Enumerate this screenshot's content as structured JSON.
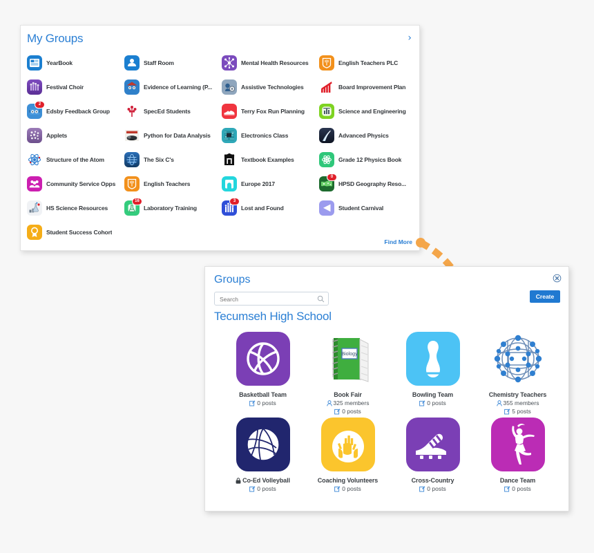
{
  "my_groups": {
    "title": "My Groups",
    "expand_icon": "chevron-right-icon",
    "find_more_label": "Find More",
    "items": [
      {
        "label": "YearBook",
        "icon": "yearbook-icon",
        "badge": null
      },
      {
        "label": "Staff Room",
        "icon": "staff-room-icon",
        "badge": null
      },
      {
        "label": "Mental Health Resources",
        "icon": "mental-health-icon",
        "badge": null
      },
      {
        "label": "English Teachers PLC",
        "icon": "book-shield-icon",
        "badge": null
      },
      {
        "label": "Festival Choir",
        "icon": "festival-choir-icon",
        "badge": null
      },
      {
        "label": "Evidence of Learning (P...",
        "icon": "robot-red-icon",
        "badge": null
      },
      {
        "label": "Assistive Technologies",
        "icon": "assistive-tech-icon",
        "badge": null
      },
      {
        "label": "Board Improvement Plan",
        "icon": "bar-chart-icon",
        "badge": null
      },
      {
        "label": "Edsby Feedback Group",
        "icon": "robot-blue-icon",
        "badge": "2"
      },
      {
        "label": "SpecEd Students",
        "icon": "tree-icon",
        "badge": null
      },
      {
        "label": "Terry Fox Run Planning",
        "icon": "running-shoe-icon",
        "badge": null
      },
      {
        "label": "Science and Engineering",
        "icon": "science-chart-icon",
        "badge": null
      },
      {
        "label": "Applets",
        "icon": "applets-icon",
        "badge": null
      },
      {
        "label": "Python for Data Analysis",
        "icon": "python-book-icon",
        "badge": null
      },
      {
        "label": "Electronics Class",
        "icon": "circuit-board-icon",
        "badge": null
      },
      {
        "label": "Advanced Physics",
        "icon": "lightning-icon",
        "badge": null
      },
      {
        "label": "Structure of the Atom",
        "icon": "atom-icon",
        "badge": null
      },
      {
        "label": "The Six C's",
        "icon": "globe-icon",
        "badge": null
      },
      {
        "label": "Textbook Examples",
        "icon": "building-icon",
        "badge": null
      },
      {
        "label": "Grade 12 Physics Book",
        "icon": "atom-green-icon",
        "badge": null
      },
      {
        "label": "Community Service Opps",
        "icon": "people-group-icon",
        "badge": null
      },
      {
        "label": "English Teachers",
        "icon": "book-shield-icon",
        "badge": null
      },
      {
        "label": "Europe 2017",
        "icon": "arch-icon",
        "badge": null
      },
      {
        "label": "HPSD Geography Reso...",
        "icon": "world-map-icon",
        "badge": "0"
      },
      {
        "label": "HS Science Resources",
        "icon": "lab-tools-icon",
        "badge": null
      },
      {
        "label": "Laboratory Training",
        "icon": "flask-icon",
        "badge": "16"
      },
      {
        "label": "Lost and Found",
        "icon": "lost-found-icon",
        "badge": "3"
      },
      {
        "label": "Student Carnival",
        "icon": "megaphone-icon",
        "badge": null
      },
      {
        "label": "Student Success Cohort",
        "icon": "award-icon",
        "badge": null
      }
    ]
  },
  "groups_dialog": {
    "title": "Groups",
    "close_icon": "close-circle-icon",
    "search": {
      "value": "",
      "placeholder": "Search",
      "icon": "search-icon"
    },
    "create_label": "Create",
    "school": "Tecumseh High School",
    "tiles": [
      {
        "name": "Basketball Team",
        "icon": "volleyball-purple-icon",
        "locked": false,
        "members": null,
        "posts": "0 posts"
      },
      {
        "name": "Book Fair",
        "icon": "green-notebook-icon",
        "locked": false,
        "members": "325 members",
        "posts": "0 posts"
      },
      {
        "name": "Bowling Team",
        "icon": "bowling-pin-icon",
        "locked": false,
        "members": null,
        "posts": "0 posts"
      },
      {
        "name": "Chemistry Teachers",
        "icon": "molecule-icon",
        "locked": false,
        "members": "355 members",
        "posts": "5 posts"
      },
      {
        "name": "Co-Ed Volleyball",
        "icon": "volleyball-navy-icon",
        "locked": true,
        "members": null,
        "posts": "0 posts"
      },
      {
        "name": "Coaching Volunteers",
        "icon": "raised-hands-icon",
        "locked": false,
        "members": null,
        "posts": "0 posts"
      },
      {
        "name": "Cross-Country",
        "icon": "cleat-shoe-icon",
        "locked": false,
        "members": null,
        "posts": "0 posts"
      },
      {
        "name": "Dance Team",
        "icon": "ballet-dancer-icon",
        "locked": false,
        "members": null,
        "posts": "0 posts"
      }
    ]
  },
  "annotation": {
    "arrow_icon": "curved-dashed-arrow",
    "arrow_color": "#f4a64a"
  },
  "colors": {
    "accent_blue": "#2b7fd4",
    "button_blue": "#2079d1",
    "badge_red": "#e0202a",
    "arrow_orange": "#f4a64a",
    "page_bg": "#f7f7f7"
  }
}
